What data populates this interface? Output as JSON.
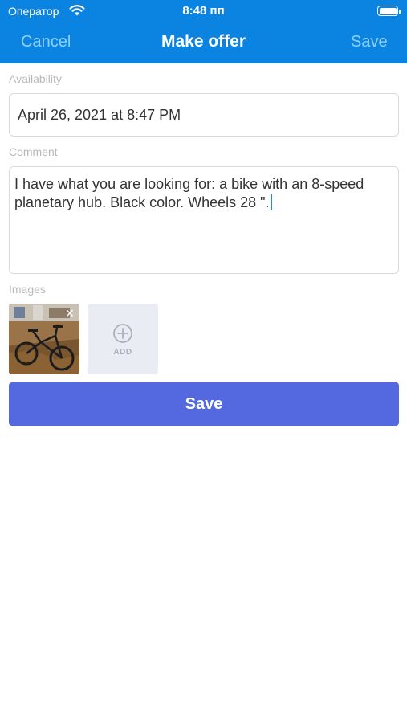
{
  "status_bar": {
    "carrier": "Оператор",
    "time": "8:48 пп",
    "wifi_icon": "wifi-icon",
    "battery_icon": "battery-icon"
  },
  "nav": {
    "cancel_label": "Cancel",
    "title": "Make offer",
    "save_label": "Save",
    "bar_color": "#0a84e0",
    "action_color": "#8ed0ff"
  },
  "form": {
    "availability": {
      "label": "Availability",
      "value": "April 26, 2021 at 8:47 PM"
    },
    "comment": {
      "label": "Comment",
      "value": "I have what you are looking for: a bike with an 8-speed planetary hub. Black color. Wheels 28 \"."
    },
    "images": {
      "label": "Images",
      "photos": [
        {
          "subject": "black bicycle on wooden floor",
          "remove_icon": "close-icon"
        }
      ],
      "add_tile": {
        "icon": "plus-circle-icon",
        "label": "ADD"
      }
    }
  },
  "save_button": {
    "label": "Save",
    "color": "#5468e0"
  }
}
